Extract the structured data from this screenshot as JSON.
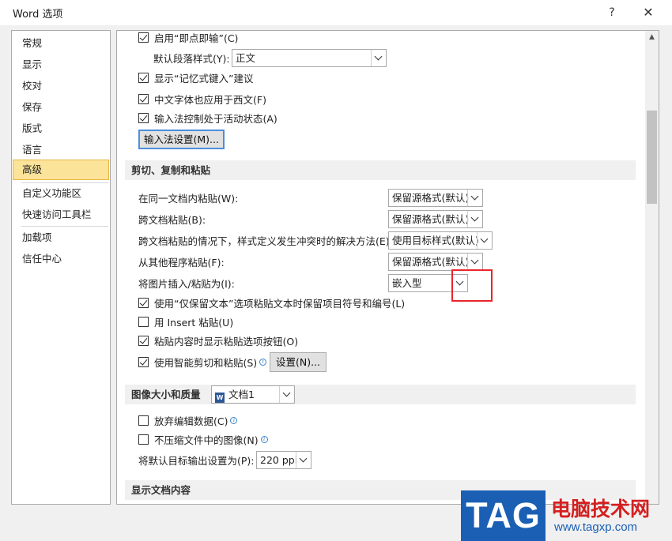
{
  "window": {
    "title": "Word 选项",
    "help_label": "?",
    "close_label": "✕"
  },
  "nav": {
    "items": [
      "常规",
      "显示",
      "校对",
      "保存",
      "版式",
      "语言",
      "高级",
      "自定义功能区",
      "快速访问工具栏",
      "加载项",
      "信任中心"
    ],
    "selected": "高级"
  },
  "editing": {
    "click_and_type": "启用“即点即输”(C)",
    "default_style_label": "默认段落样式(Y):",
    "default_style_value": "正文",
    "autocomplete": "显示“记忆式键入”建议",
    "chinese_font_western": "中文字体也应用于西文(F)",
    "ime_active": "输入法控制处于活动状态(A)",
    "ime_settings_button": "输入法设置(M)..."
  },
  "cut_copy_paste": {
    "header": "剪切、复制和粘贴",
    "rows": [
      {
        "label": "在同一文档内粘贴(W):",
        "value": "保留源格式(默认)"
      },
      {
        "label": "跨文档粘贴(B):",
        "value": "保留源格式(默认)"
      },
      {
        "label": "跨文档粘贴的情况下，样式定义发生冲突时的解决方法(E):",
        "value": "使用目标样式(默认)"
      },
      {
        "label": "从其他程序粘贴(F):",
        "value": "保留源格式(默认)"
      },
      {
        "label": "将图片插入/粘贴为(I):",
        "value": "嵌入型"
      }
    ],
    "keep_text_only": "使用“仅保留文本”选项粘贴文本时保留项目符号和编号(L)",
    "use_insert_key": "用 Insert 粘贴(U)",
    "show_paste_options": "粘贴内容时显示粘贴选项按钮(O)",
    "smart_cut_paste": "使用智能剪切和粘贴(S)",
    "settings_button": "设置(N)..."
  },
  "image_size": {
    "header": "图像大小和质量",
    "document_value": "文档1",
    "discard_editing": "放弃编辑数据(C)",
    "no_compress": "不压缩文件中的图像(N)",
    "default_output_label": "将默认目标输出设置为(P):",
    "default_output_value": "220 ppi"
  },
  "show_document_content": {
    "header": "显示文档内容"
  },
  "watermark": {
    "tag": "TAG",
    "site_name": "电脑技术网",
    "url": "www.tagxp.com"
  },
  "colors": {
    "selected_bg": "#fbe39a",
    "highlight_box": "#e8262c",
    "watermark_blue": "#1a5fb4",
    "watermark_red": "#d42020"
  }
}
